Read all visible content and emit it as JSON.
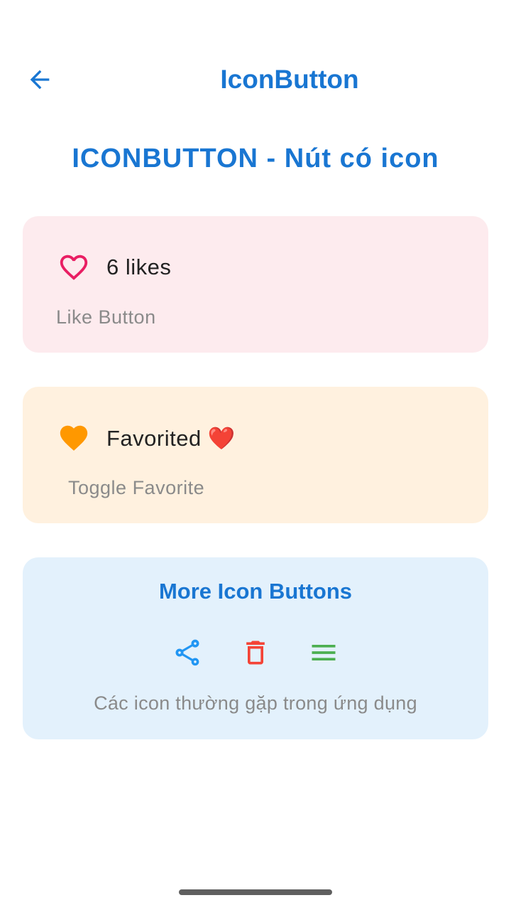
{
  "app_bar": {
    "title": "IconButton",
    "back_icon": "arrow-back-icon",
    "accent_color": "#1976D2"
  },
  "heading": "ICONBUTTON - Nút có icon",
  "like_card": {
    "count_label": "6 likes",
    "caption": "Like Button",
    "icon": "heart-outline-icon",
    "icon_color": "#E91E63",
    "background": "#FDEBEE"
  },
  "favorite_card": {
    "status_label": "Favorited ❤️",
    "caption": "Toggle Favorite",
    "icon": "heart-filled-icon",
    "icon_color": "#FF9800",
    "background": "#FFF1DF"
  },
  "more_card": {
    "title": "More Icon Buttons",
    "caption": "Các icon thường gặp trong ứng dụng",
    "background": "#E3F1FC",
    "icons": [
      {
        "name": "share-icon",
        "color": "#2196F3"
      },
      {
        "name": "delete-icon",
        "color": "#F44336"
      },
      {
        "name": "menu-icon",
        "color": "#4CAF50"
      }
    ]
  }
}
